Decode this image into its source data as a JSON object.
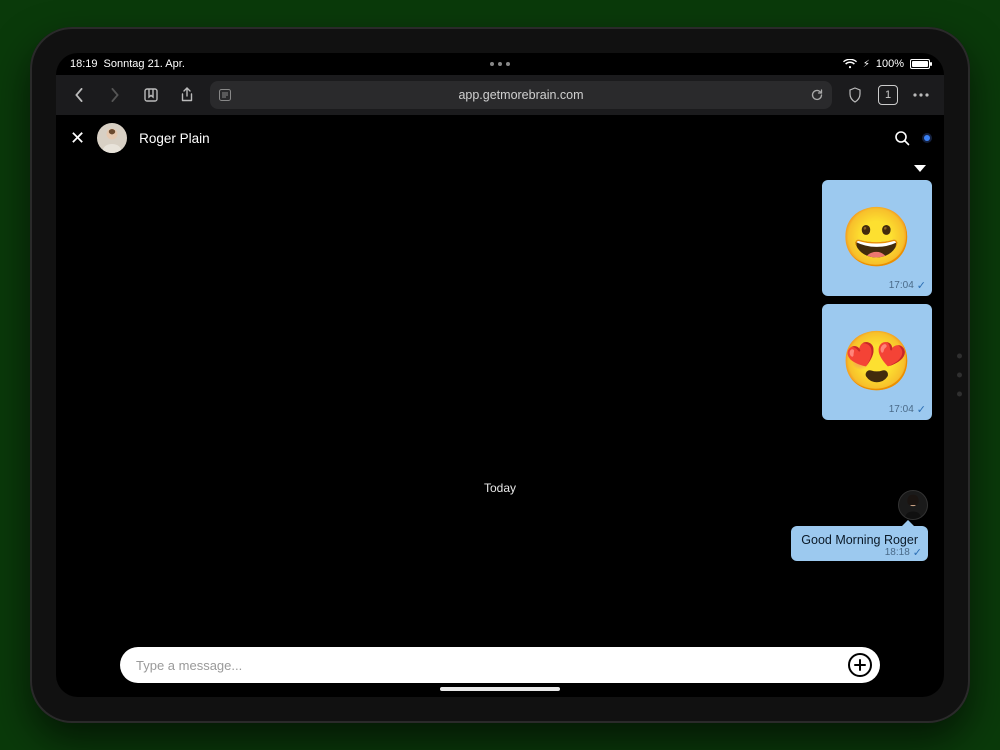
{
  "status": {
    "time": "18:19",
    "date": "Sonntag 21. Apr.",
    "battery": "100%"
  },
  "browser": {
    "url": "app.getmorebrain.com",
    "tab_count": "1"
  },
  "chat": {
    "contact_name": "Roger Plain",
    "date_separator": "Today",
    "messages": [
      {
        "emoji": "😀",
        "time": "17:04"
      },
      {
        "emoji": "😍",
        "time": "17:04"
      },
      {
        "text": "Good Morning Roger",
        "time": "18:18"
      }
    ],
    "composer_placeholder": "Type a message..."
  }
}
